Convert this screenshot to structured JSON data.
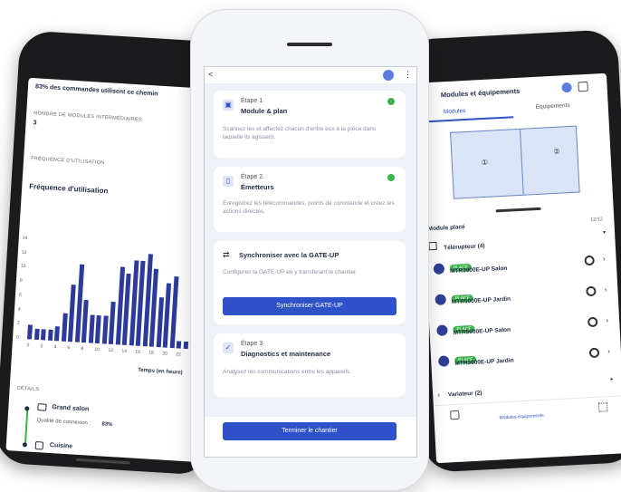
{
  "left": {
    "header": "83% des commandes utilisent ce chemin",
    "intermediate_label": "NOMBRE DE MODULES INTERMÉDIAIRES",
    "intermediate_value": "3",
    "frequency_label": "FRÉQUENCE D'UTILISATION",
    "chart_title": "Fréquence d'utilisation",
    "xlabel": "Temps (en heure)",
    "detail_label": "DÉTAILS",
    "room1": "Grand salon",
    "quality_label": "Qualité de connexion :",
    "quality_value": "83%",
    "room2": "Cuisine",
    "chart_data": {
      "type": "bar",
      "categories": [
        "0",
        "1",
        "2",
        "3",
        "4",
        "5",
        "6",
        "7",
        "8",
        "9",
        "10",
        "11",
        "12",
        "13",
        "14",
        "15",
        "16",
        "17",
        "18",
        "19",
        "20",
        "21",
        "22",
        "23"
      ],
      "values": [
        2,
        1.5,
        1.5,
        1.5,
        2,
        4,
        8,
        11,
        6,
        4,
        4,
        4,
        6,
        11,
        10,
        12,
        12,
        13,
        11,
        7,
        9,
        10,
        1,
        1
      ],
      "xticks": [
        "0",
        "2",
        "4",
        "6",
        "8",
        "10",
        "12",
        "14",
        "16",
        "18",
        "20",
        "22"
      ],
      "yticks": [
        "14",
        "12",
        "10",
        "8",
        "6",
        "4",
        "2",
        "0"
      ],
      "ylim": [
        0,
        14
      ]
    }
  },
  "center": {
    "back_label": "<",
    "menu_label": "⋮",
    "step1_num": "Étape 1",
    "step1_title": "Module & plan",
    "step1_desc": "Scannez les et affectez chacun d'entre eux à la pièce dans laquelle ils agissent.",
    "step2_num": "Étape 2",
    "step2_title": "Émetteurs",
    "step2_desc": "Enregistrez les télécommandes, points de commande et créez les actions directes.",
    "sync_title": "Synchroniser avec la GATE-UP",
    "sync_desc": "Configurez la GATE-UP en y transférant le chantier.",
    "sync_button": "Synchroniser GATE-UP",
    "step3_num": "Étape 3",
    "step3_title": "Diagnostics et maintenance",
    "step3_desc": "Analysez les communications entre les appareils.",
    "finish_button": "Terminer le chantier"
  },
  "right": {
    "title": "Modules et équipements",
    "tab_modules": "Modules",
    "tab_equipments": "Équipements",
    "placed_label": "Module placé",
    "placed_count": "12/12",
    "group1": "Télérupteur (4)",
    "badge": "PLACÉ",
    "devices": [
      {
        "name": "MTR3000E-UP Salon"
      },
      {
        "name": "MTR5000E-UP Jardin"
      },
      {
        "name": "MTR5000E-UP Salon"
      },
      {
        "name": "MTR3000E-UP Jardin"
      }
    ],
    "group2": "Variateur (2)",
    "bottom_nav": "Modules-équipements",
    "plan_room1": "①",
    "plan_room2": "②"
  },
  "colors": {
    "accent": "#2f52c9",
    "bars": "#2c3a9c",
    "success": "#3bb34a"
  }
}
